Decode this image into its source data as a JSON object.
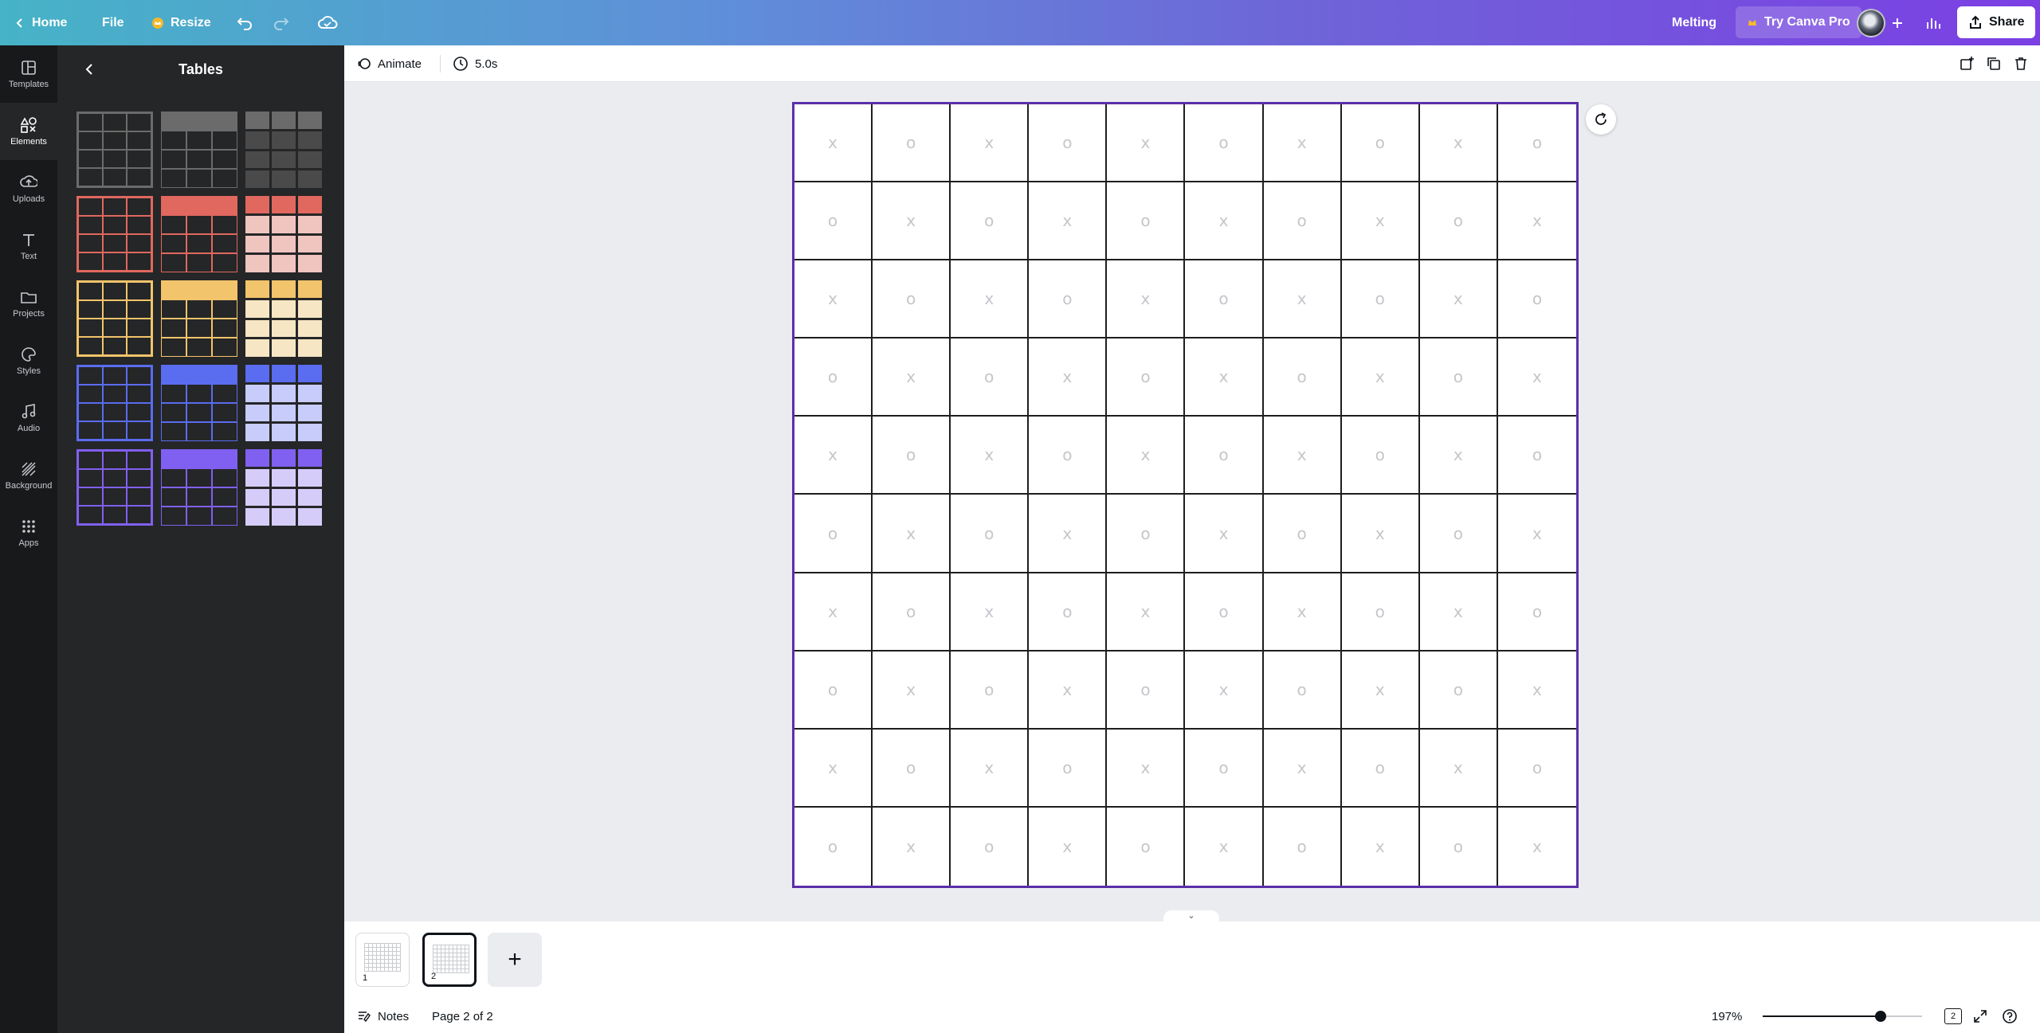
{
  "topbar": {
    "home_label": "Home",
    "file_label": "File",
    "resize_label": "Resize",
    "design_title": "Melting",
    "try_pro_label": "Try Canva Pro",
    "share_label": "Share"
  },
  "rail": {
    "items": [
      {
        "label": "Templates",
        "icon": "templates-icon"
      },
      {
        "label": "Elements",
        "icon": "elements-icon",
        "active": true
      },
      {
        "label": "Uploads",
        "icon": "uploads-icon"
      },
      {
        "label": "Text",
        "icon": "text-icon"
      },
      {
        "label": "Projects",
        "icon": "projects-icon"
      },
      {
        "label": "Styles",
        "icon": "styles-icon"
      },
      {
        "label": "Audio",
        "icon": "audio-icon"
      },
      {
        "label": "Background",
        "icon": "background-icon"
      },
      {
        "label": "Apps",
        "icon": "apps-icon"
      }
    ]
  },
  "panel": {
    "title": "Tables",
    "table_colors": [
      {
        "main": "#6b6b6b",
        "light": "#4a4a4a"
      },
      {
        "main": "#e0685e",
        "light": "#f0c4bf"
      },
      {
        "main": "#f2c46b",
        "light": "#f7e6c4"
      },
      {
        "main": "#5a6cf0",
        "light": "#c7ccfa"
      },
      {
        "main": "#8060f0",
        "light": "#d6ccfa"
      }
    ]
  },
  "subbar": {
    "animate_label": "Animate",
    "duration_label": "5.0s"
  },
  "canvas": {
    "page_border_color": "#5b2fa8",
    "symbols": [
      "x",
      "o"
    ]
  },
  "pages": {
    "thumbs": [
      {
        "number": "1"
      },
      {
        "number": "2",
        "active": true
      }
    ],
    "add_label": "+"
  },
  "footer": {
    "notes_label": "Notes",
    "page_indicator": "Page 2 of 2",
    "zoom_label": "197%",
    "zoom_fraction": 0.74,
    "page_count_badge": "2"
  }
}
